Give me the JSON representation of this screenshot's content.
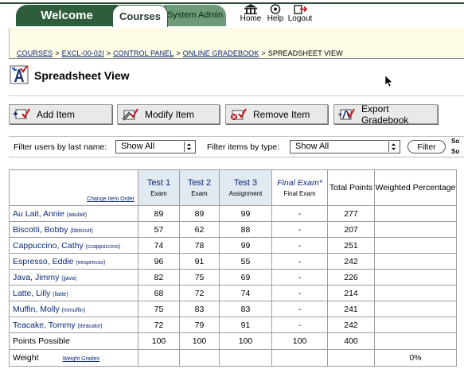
{
  "nav": {
    "tabs": [
      {
        "label": "Welcome"
      },
      {
        "label": "Courses"
      },
      {
        "label": "System Admin"
      }
    ],
    "icons": [
      {
        "label": "Home",
        "icon": "home-icon"
      },
      {
        "label": "Help",
        "icon": "help-icon"
      },
      {
        "label": "Logout",
        "icon": "logout-icon"
      }
    ]
  },
  "breadcrumb": {
    "items": [
      "COURSES",
      "EXCL-00-02I",
      "CONTROL PANEL",
      "ONLINE GRADEBOOK"
    ],
    "current": "SPREADSHEET VIEW",
    "separator": ">"
  },
  "page": {
    "title": "Spreadsheet View"
  },
  "actions": {
    "add": "Add Item",
    "modify": "Modify Item",
    "remove": "Remove Item",
    "export": "Export Gradebook"
  },
  "filters": {
    "users_label": "Filter users by last name:",
    "users_value": "Show All",
    "items_label": "Filter items by type:",
    "items_value": "Show All",
    "filter_button": "Filter",
    "sort_fragment_1": "So",
    "sort_fragment_2": "So"
  },
  "table": {
    "change_order_link": "Change Item Order",
    "columns": [
      {
        "title": "Test 1",
        "sub": "Exam"
      },
      {
        "title": "Test 2",
        "sub": "Exam"
      },
      {
        "title": "Test 3",
        "sub": "Assignment"
      },
      {
        "title": "Final Exam*",
        "sub": "Final Exam"
      },
      {
        "title": "Total Points",
        "sub": ""
      },
      {
        "title": "Weighted Percentage",
        "sub": ""
      }
    ],
    "rows": [
      {
        "name": "Au Lait, Annie",
        "login": "(aaulait)",
        "scores": [
          "89",
          "89",
          "99",
          "-",
          "277",
          ""
        ]
      },
      {
        "name": "Biscotti, Bobby",
        "login": "(bbiscuit)",
        "scores": [
          "57",
          "62",
          "88",
          "-",
          "207",
          ""
        ]
      },
      {
        "name": "Cappuccino, Cathy",
        "login": "(ccappuccino)",
        "scores": [
          "74",
          "78",
          "99",
          "-",
          "251",
          ""
        ]
      },
      {
        "name": "Espresso, Eddie",
        "login": "(eespresso)",
        "scores": [
          "96",
          "91",
          "55",
          "-",
          "242",
          ""
        ]
      },
      {
        "name": "Java, Jimmy",
        "login": "(jjava)",
        "scores": [
          "82",
          "75",
          "69",
          "-",
          "226",
          ""
        ]
      },
      {
        "name": "Latte, Lilly",
        "login": "(llatte)",
        "scores": [
          "68",
          "72",
          "74",
          "-",
          "214",
          ""
        ]
      },
      {
        "name": "Muffin, Molly",
        "login": "(mmuffin)",
        "scores": [
          "75",
          "83",
          "83",
          "-",
          "241",
          ""
        ]
      },
      {
        "name": "Teacake, Tommy",
        "login": "(tteacake)",
        "scores": [
          "72",
          "79",
          "91",
          "-",
          "242",
          ""
        ]
      }
    ],
    "points_possible": {
      "label": "Points Possible",
      "values": [
        "100",
        "100",
        "100",
        "100",
        "400",
        ""
      ]
    },
    "weight": {
      "label": "Weight",
      "link": "Weight Grades",
      "values": [
        "",
        "",
        "",
        "",
        "",
        "0%"
      ]
    }
  }
}
